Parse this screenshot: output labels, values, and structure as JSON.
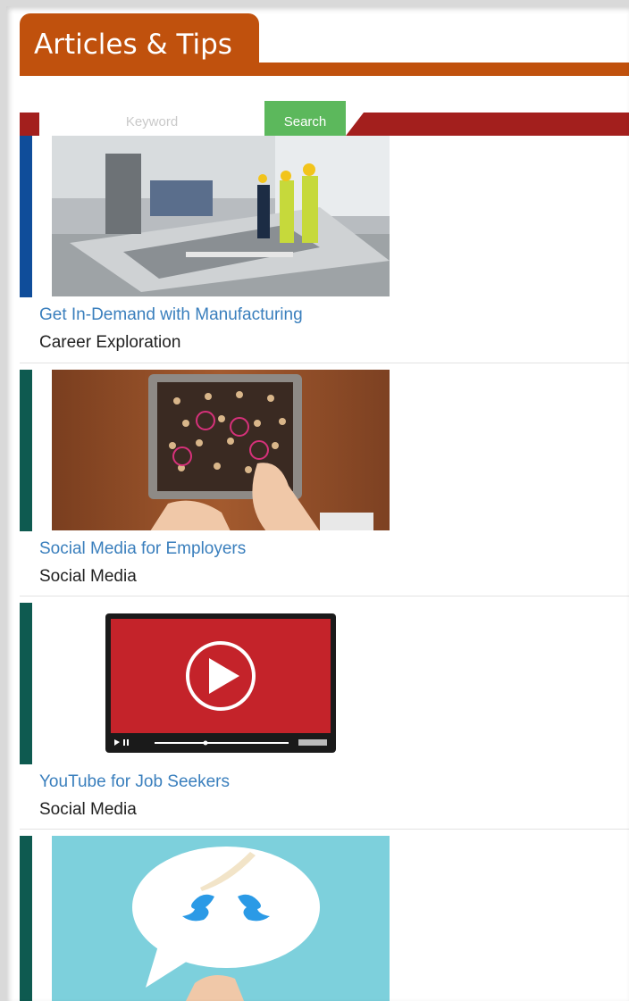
{
  "header": {
    "title": "Articles & Tips"
  },
  "search": {
    "placeholder": "Keyword",
    "button_label": "Search"
  },
  "colors": {
    "header_orange": "#c0510d",
    "search_red": "#a31f1d",
    "search_green": "#5cb85c",
    "link_blue": "#3a7fbd",
    "accent_blue": "#0f4d9a",
    "accent_teal": "#0e5a50"
  },
  "articles": [
    {
      "title": "Get In-Demand with Manufacturing",
      "category": "Career Exploration",
      "accent": "#0f4d9a",
      "image": "manufacturing-workers-photo"
    },
    {
      "title": "Social Media for Employers",
      "category": "Social Media",
      "accent": "#0e5a50",
      "image": "social-network-tablet-photo"
    },
    {
      "title": "YouTube for Job Seekers",
      "category": "Social Media",
      "accent": "#0e5a50",
      "image": "video-player-illustration"
    },
    {
      "title": "",
      "category": "",
      "accent": "#0e5a50",
      "image": "twitter-birds-speech-bubble-photo"
    }
  ]
}
